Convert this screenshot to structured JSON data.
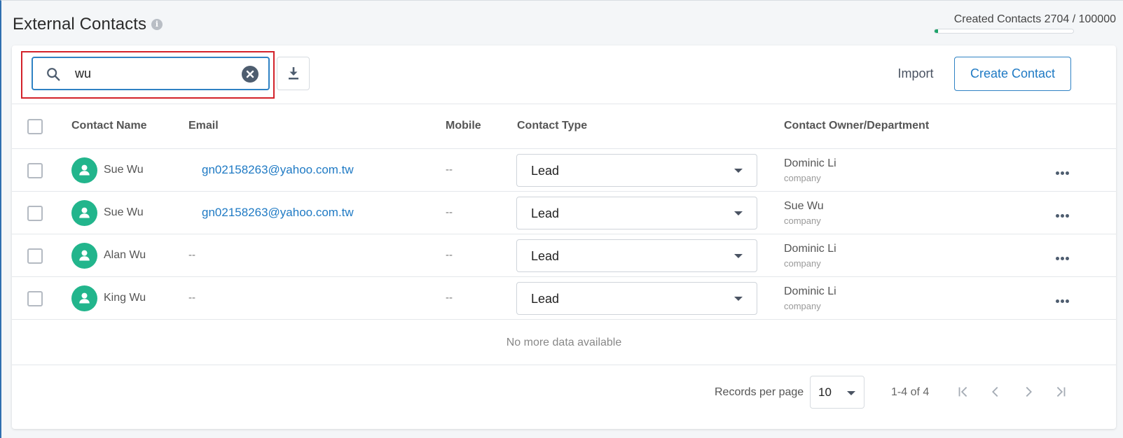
{
  "header": {
    "title": "External Contacts",
    "info_icon": "info-icon",
    "quota_label": "Created Contacts 2704 / 100000",
    "quota_used": 2704,
    "quota_total": 100000
  },
  "toolbar": {
    "search_value": "wu",
    "search_icon": "search-icon",
    "clear_icon": "clear-circle-icon",
    "download_icon": "download-icon",
    "import_label": "Import",
    "create_label": "Create Contact",
    "colors": {
      "accent": "#1f7ac4",
      "highlight": "#d3222a",
      "avatar": "#22b58c"
    }
  },
  "table": {
    "columns": {
      "name": "Contact Name",
      "email": "Email",
      "mobile": "Mobile",
      "type": "Contact Type",
      "owner": "Contact Owner/Department"
    },
    "rows": [
      {
        "name": "Sue Wu",
        "email": "gn02158263@yahoo.com.tw",
        "mobile": "--",
        "type": "Lead",
        "owner": "Dominic Li",
        "department": "company"
      },
      {
        "name": "Sue Wu",
        "email": "gn02158263@yahoo.com.tw",
        "mobile": "--",
        "type": "Lead",
        "owner": "Sue Wu",
        "department": "company"
      },
      {
        "name": "Alan Wu",
        "email": "--",
        "mobile": "--",
        "type": "Lead",
        "owner": "Dominic Li",
        "department": "company"
      },
      {
        "name": "King Wu",
        "email": "--",
        "mobile": "--",
        "type": "Lead",
        "owner": "Dominic Li",
        "department": "company"
      }
    ],
    "no_more_text": "No more data available"
  },
  "footer": {
    "records_per_page_label": "Records per page",
    "records_per_page": "10",
    "range_text": "1-4 of 4",
    "pager_icons": [
      "first-page-icon",
      "prev-page-icon",
      "next-page-icon",
      "last-page-icon"
    ]
  }
}
